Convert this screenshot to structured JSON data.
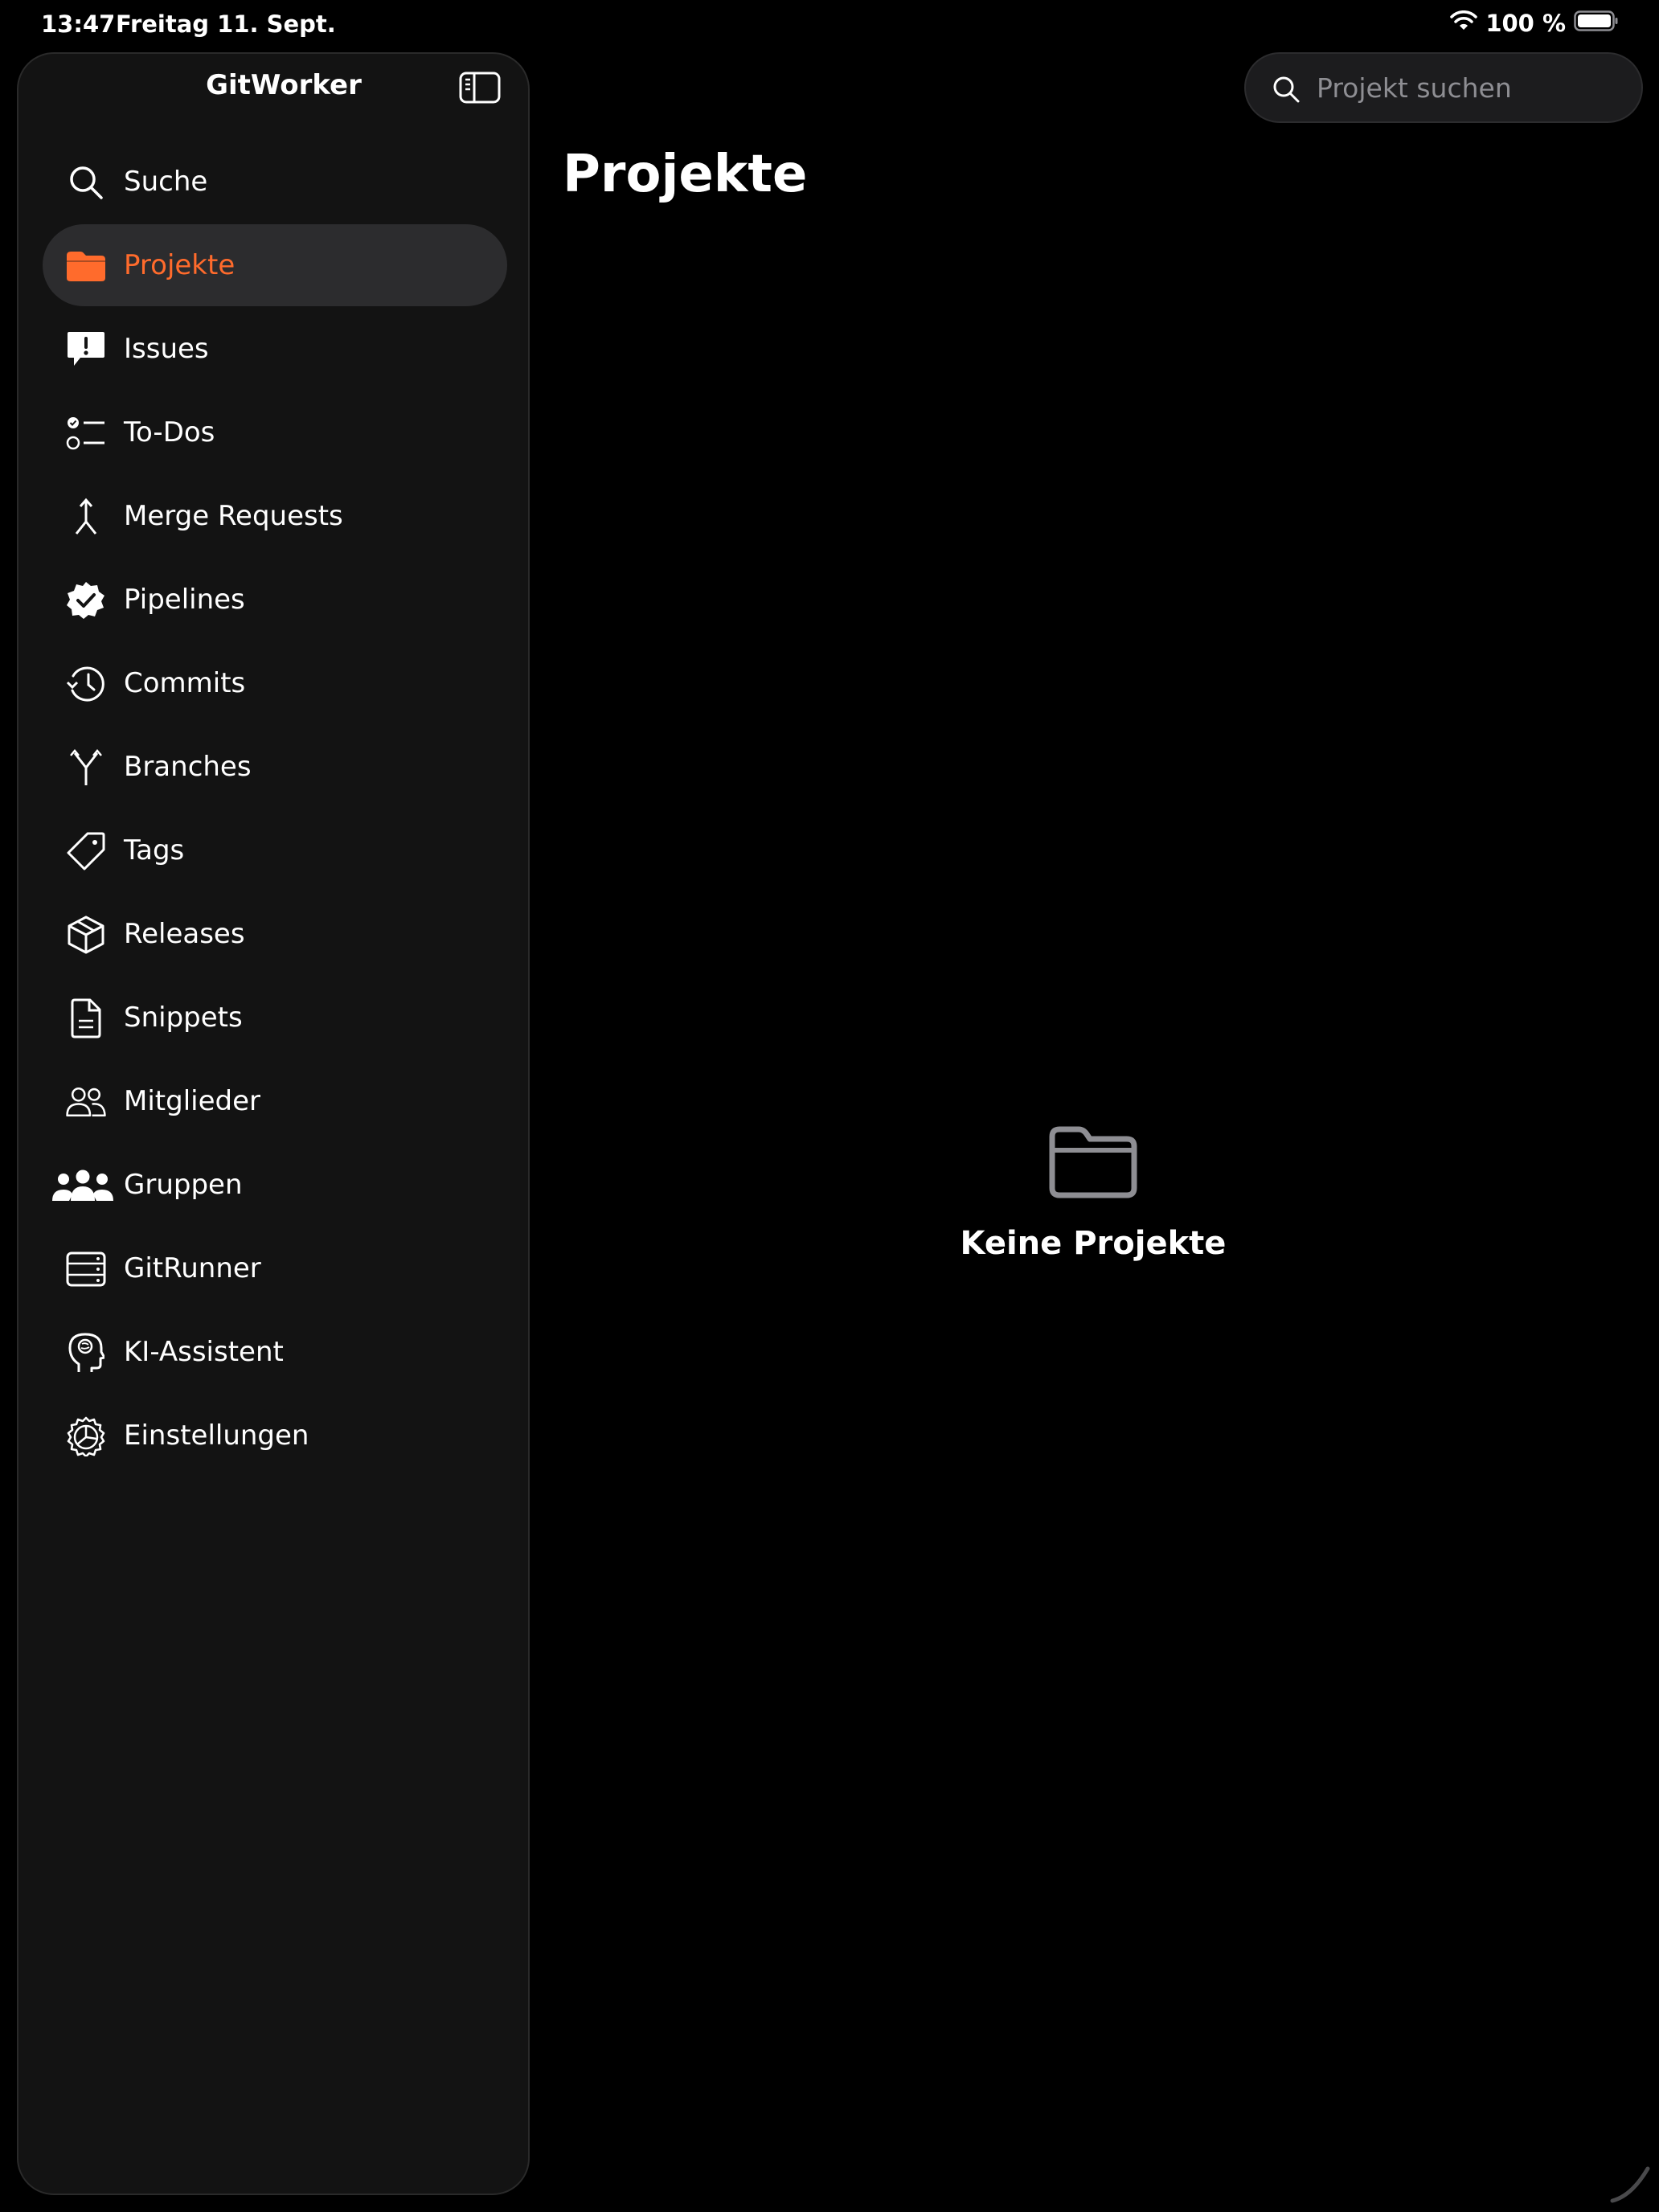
{
  "status_bar": {
    "time": "13:47",
    "date": "Freitag 11. Sept.",
    "battery": "100 %",
    "wifi_icon": "wifi-icon",
    "battery_icon": "battery-icon"
  },
  "sidebar": {
    "title": "GitWorker",
    "toggle_icon": "sidebar-toggle-icon",
    "items": [
      {
        "label": "Suche",
        "icon": "search-icon",
        "active": false
      },
      {
        "label": "Projekte",
        "icon": "folder-icon",
        "active": true
      },
      {
        "label": "Issues",
        "icon": "issue-bubble-icon",
        "active": false
      },
      {
        "label": "To-Dos",
        "icon": "checklist-icon",
        "active": false
      },
      {
        "label": "Merge Requests",
        "icon": "merge-icon",
        "active": false
      },
      {
        "label": "Pipelines",
        "icon": "verified-badge-icon",
        "active": false
      },
      {
        "label": "Commits",
        "icon": "history-clock-icon",
        "active": false
      },
      {
        "label": "Branches",
        "icon": "branch-icon",
        "active": false
      },
      {
        "label": "Tags",
        "icon": "tag-icon",
        "active": false
      },
      {
        "label": "Releases",
        "icon": "package-box-icon",
        "active": false
      },
      {
        "label": "Snippets",
        "icon": "document-icon",
        "active": false
      },
      {
        "label": "Mitglieder",
        "icon": "two-people-icon",
        "active": false
      },
      {
        "label": "Gruppen",
        "icon": "three-people-icon",
        "active": false
      },
      {
        "label": "GitRunner",
        "icon": "server-rack-icon",
        "active": false
      },
      {
        "label": "KI-Assistent",
        "icon": "brain-head-icon",
        "active": false
      },
      {
        "label": "Einstellungen",
        "icon": "gear-icon",
        "active": false
      }
    ]
  },
  "search": {
    "placeholder": "Projekt suchen",
    "value": ""
  },
  "main": {
    "title": "Projekte",
    "empty_state": {
      "icon": "empty-folder-icon",
      "title": "Keine Projekte"
    }
  },
  "colors": {
    "accent": "#ff6b2c",
    "background": "#000000",
    "sidebar_bg": "#131313",
    "active_row": "#2c2c2e",
    "placeholder": "#8e8e93"
  }
}
